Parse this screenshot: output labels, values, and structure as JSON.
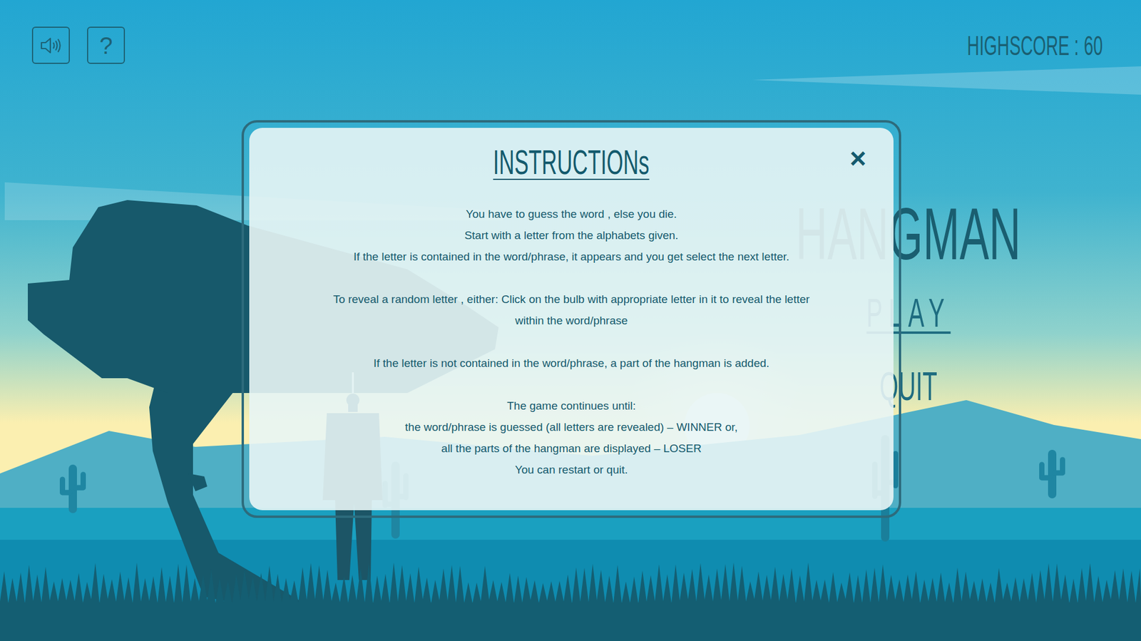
{
  "toolbar": {
    "sound": {
      "muted": false
    },
    "help": {
      "label": "?"
    }
  },
  "highscore": {
    "label": "HIGHSCORE :",
    "value": "60"
  },
  "menu": {
    "title": "HANGMAN",
    "items": [
      {
        "label": "PLAY",
        "selected": true
      },
      {
        "label": "QUIT",
        "selected": false
      }
    ]
  },
  "modal": {
    "title": "INSTRUCTIONs",
    "close": "×",
    "paragraphs": [
      [
        "You have to guess the word , else you die.",
        "Start with a letter from the alphabets given.",
        "If the letter is contained in the word/phrase, it appears and you get select the next letter."
      ],
      [
        "To reveal a random letter , either: Click on the bulb with appropriate letter in it to reveal the letter",
        "within the word/phrase"
      ],
      [
        "If the letter is not contained in the word/phrase, a part of the hangman is added."
      ],
      [
        "The game continues until:",
        "the word/phrase is guessed (all letters are revealed) – WINNER or,",
        "all the parts of the hangman are displayed – LOSER",
        "You can restart or quit."
      ]
    ]
  }
}
